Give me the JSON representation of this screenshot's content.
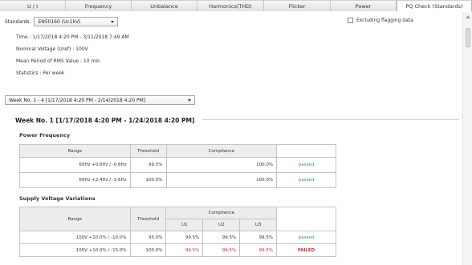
{
  "tabs": [
    {
      "label": "U / I",
      "active": false
    },
    {
      "label": "Frequency",
      "active": false
    },
    {
      "label": "Unbalance",
      "active": false
    },
    {
      "label": "Harmonics(THD)",
      "active": false
    },
    {
      "label": "Flicker",
      "active": false
    },
    {
      "label": "Power",
      "active": false
    },
    {
      "label": "PQ Check (Standards)",
      "active": true
    }
  ],
  "standards": {
    "label": "Standards:",
    "value": "EN50160 (Uc1kV)"
  },
  "exclude_flagging": {
    "label": "Excluding flagging data",
    "checked": false
  },
  "info": {
    "time": "Time :  1/17/2018 4:20 PM - 3/11/2018 7:49 AM",
    "nominal": "Nominal Voltage (Uref) :  100V",
    "mean_period": "Mean Period of RMS Value :  10 min",
    "statistics": "Statistics :  Per week"
  },
  "week_select": {
    "value": "Week No. 1 - 4 [1/17/2018 4:20 PM - 2/14/2018 4:20 PM]"
  },
  "week_heading": "Week No. 1 [1/17/2018 4:20 PM - 1/24/2018 4:20 PM]",
  "power_frequency": {
    "title": "Power Frequency",
    "headers": {
      "range": "Range",
      "threshold": "Threshold",
      "compliance": "Compliance"
    },
    "rows": [
      {
        "range": "60Hz +0.6Hz / -0.6Hz",
        "threshold": "99.5%",
        "compliance": "100.0%",
        "status": "passed"
      },
      {
        "range": "60Hz +2.4Hz / -3.6Hz",
        "threshold": "100.0%",
        "compliance": "100.0%",
        "status": "passed"
      }
    ]
  },
  "supply_voltage": {
    "title": "Supply Voltage Variations",
    "headers": {
      "range": "Range",
      "threshold": "Threshold",
      "compliance": "Compliance",
      "u1": "U1",
      "u2": "U2",
      "u3": "U3"
    },
    "rows": [
      {
        "range": "100V  +10.0% / -10.0%",
        "threshold": "95.0%",
        "u1": "99.5%",
        "u2": "99.5%",
        "u3": "99.5%",
        "status": "passed"
      },
      {
        "range": "100V  +10.0% / -15.0%",
        "threshold": "100.0%",
        "u1": "99.5%",
        "u2": "99.5%",
        "u3": "99.5%",
        "status": "FAILED"
      }
    ]
  },
  "colors": {
    "passed": "#2e9c2e",
    "failed": "#e02020"
  }
}
